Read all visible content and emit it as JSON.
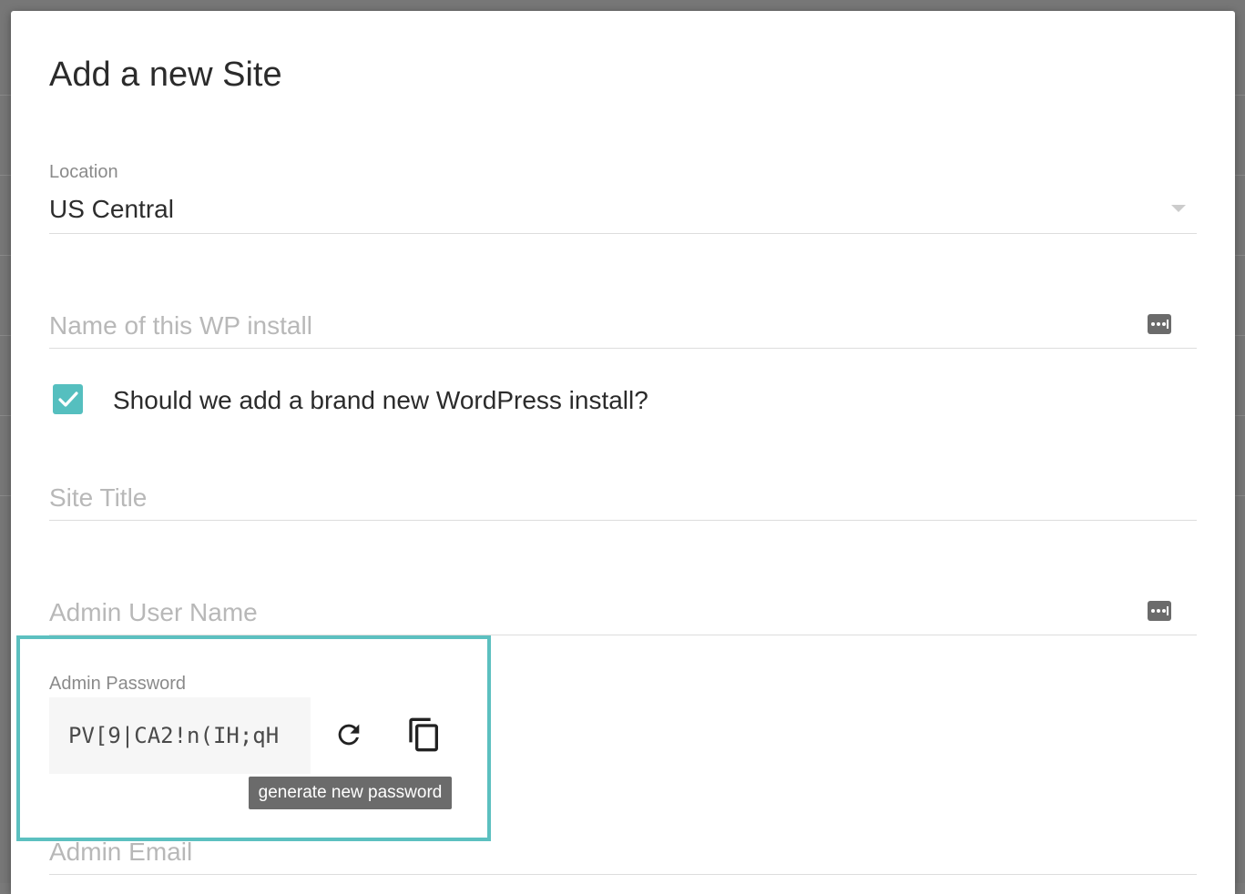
{
  "modal": {
    "title": "Add a new Site"
  },
  "location": {
    "label": "Location",
    "value": "US Central"
  },
  "install_name": {
    "placeholder": "Name of this WP install",
    "value": ""
  },
  "new_install": {
    "checked": true,
    "label": "Should we add a brand new WordPress install?"
  },
  "site_title": {
    "placeholder": "Site Title",
    "value": ""
  },
  "admin_user": {
    "placeholder": "Admin User Name",
    "value": ""
  },
  "admin_password": {
    "label": "Admin Password",
    "value": "PV[9|CA2!n(IH;qH",
    "tooltip": "generate new password"
  },
  "admin_email": {
    "placeholder": "Admin Email",
    "value": ""
  },
  "colors": {
    "accent": "#55bfbf",
    "highlight_border": "#5cc0c0",
    "tooltip_bg": "#6b6b6b"
  },
  "icons": {
    "select_caret": "chevron-down-icon",
    "password_manager": "password-dots-icon",
    "checkbox": "checkmark-icon",
    "regenerate": "refresh-icon",
    "copy": "copy-icon"
  }
}
